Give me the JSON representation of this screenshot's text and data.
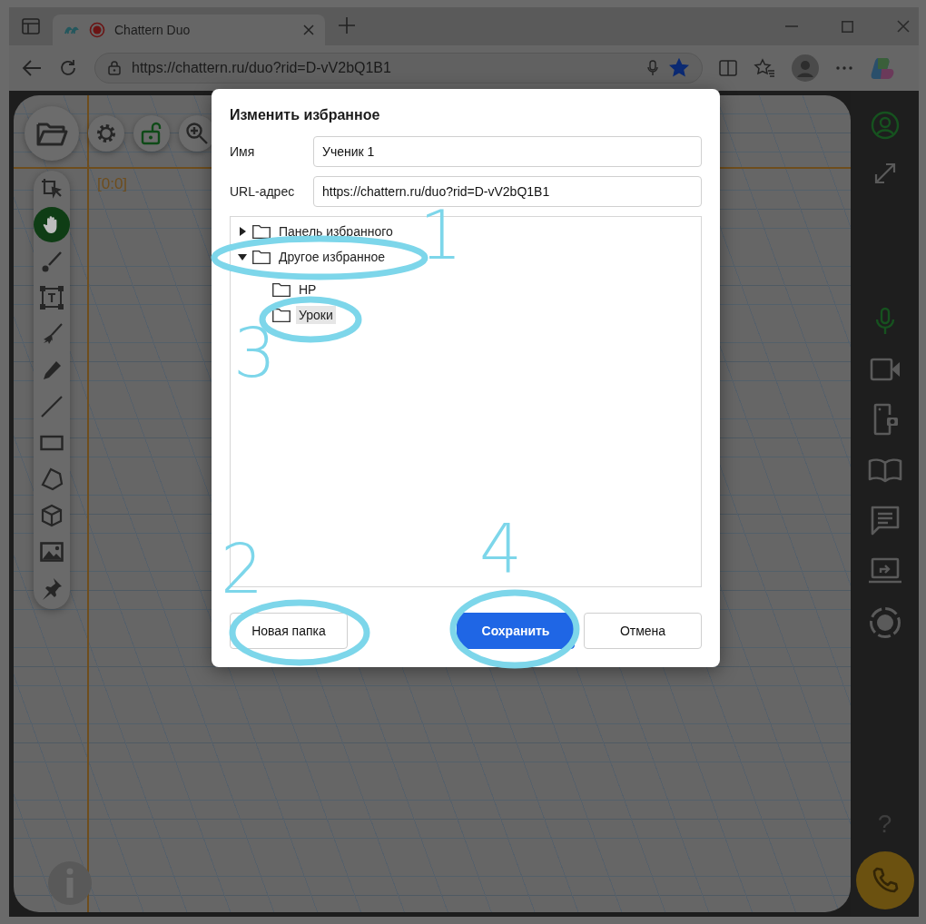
{
  "browser": {
    "tab_title": "Chattern Duo",
    "recording": true,
    "address": "https://chattern.ru/duo?rid=D-vV2bQ1B1",
    "bookmarked": true
  },
  "canvas": {
    "origin_label": "[0:0]",
    "top_buttons": [
      {
        "kind": "folder"
      },
      {
        "kind": "settings"
      },
      {
        "kind": "lock"
      },
      {
        "kind": "zoom"
      }
    ],
    "tools": [
      {
        "kind": "select",
        "selected": false
      },
      {
        "kind": "hand",
        "selected": true
      },
      {
        "kind": "brush",
        "selected": false
      },
      {
        "kind": "text",
        "selected": false
      },
      {
        "kind": "broom",
        "selected": false
      },
      {
        "kind": "pencil",
        "selected": false
      },
      {
        "kind": "line",
        "selected": false
      },
      {
        "kind": "rectangle",
        "selected": false
      },
      {
        "kind": "polygon",
        "selected": false
      },
      {
        "kind": "cube",
        "selected": false
      },
      {
        "kind": "image",
        "selected": false
      },
      {
        "kind": "pin",
        "selected": false
      }
    ]
  },
  "sidebar": {
    "mic_on": true,
    "help_label": "?"
  },
  "dialog": {
    "title": "Изменить избранное",
    "fields": [
      {
        "label": "Имя",
        "value": "Ученик 1"
      },
      {
        "label": "URL-адрес",
        "value": "https://chattern.ru/duo?rid=D-vV2bQ1B1"
      }
    ],
    "folders": [
      {
        "name": "Панель избранного",
        "expanded": false,
        "selected": false
      },
      {
        "name": "Другое избранное",
        "expanded": true,
        "selected": false,
        "children": [
          {
            "name": "НР",
            "selected": false
          },
          {
            "name": "Уроки",
            "selected": true
          }
        ]
      }
    ],
    "buttons": [
      {
        "label": "Новая папка",
        "kind": "secondary"
      },
      {
        "label": "Сохранить",
        "kind": "primary"
      },
      {
        "label": "Отмена",
        "kind": "secondary"
      }
    ]
  },
  "annotations": [
    {
      "label": "1"
    },
    {
      "label": "2"
    },
    {
      "label": "3"
    },
    {
      "label": "4"
    }
  ]
}
